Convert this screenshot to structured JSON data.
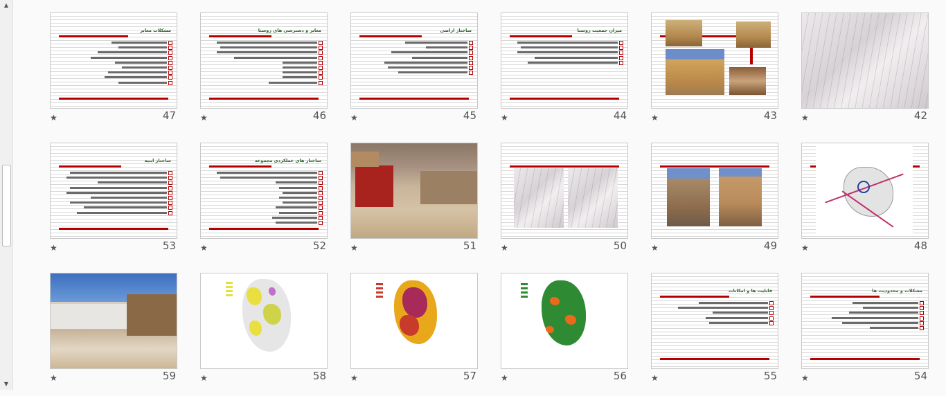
{
  "slides": [
    {
      "num": "47",
      "title": "مشکلات معابر"
    },
    {
      "num": "46",
      "title": "معابر و دسترسی های روستا"
    },
    {
      "num": "45",
      "title": "ساختار اراضی"
    },
    {
      "num": "44",
      "title": "میزان جمعیت روستا"
    },
    {
      "num": "43",
      "title": ""
    },
    {
      "num": "42",
      "title": ""
    },
    {
      "num": "53",
      "title": "ساختار ابنیه"
    },
    {
      "num": "52",
      "title": "ساختار های عملکردی مجموعه"
    },
    {
      "num": "51",
      "title": ""
    },
    {
      "num": "50",
      "title": ""
    },
    {
      "num": "49",
      "title": ""
    },
    {
      "num": "48",
      "title": ""
    },
    {
      "num": "59",
      "title": ""
    },
    {
      "num": "58",
      "title": ""
    },
    {
      "num": "57",
      "title": ""
    },
    {
      "num": "56",
      "title": ""
    },
    {
      "num": "55",
      "title": "قابلیت ها و امکانات"
    },
    {
      "num": "54",
      "title": "مشکلات و محدودیت ها"
    }
  ],
  "star_icon": "★",
  "colors": {
    "accent_red": "#b40000",
    "title_green": "#2e6b2e"
  }
}
